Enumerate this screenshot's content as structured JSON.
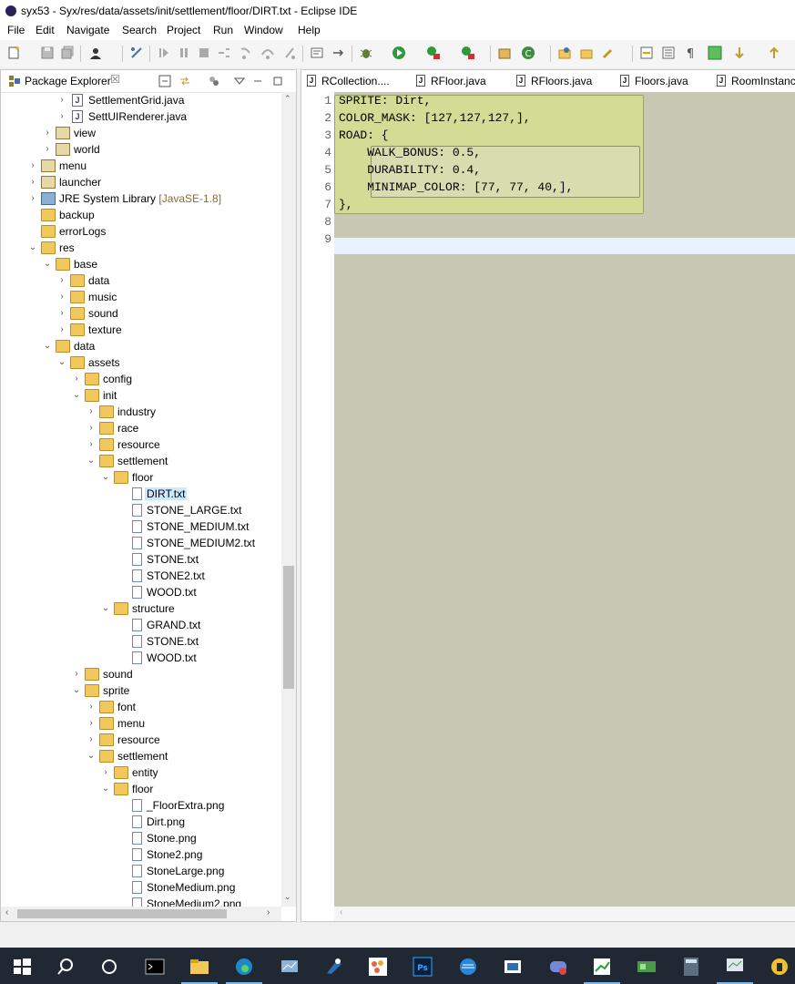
{
  "window": {
    "title": "syx53 - Syx/res/data/assets/init/settlement/floor/DIRT.txt - Eclipse IDE"
  },
  "menu": {
    "items": [
      "File",
      "Edit",
      "Navigate",
      "Search",
      "Project",
      "Run",
      "Window",
      "Help"
    ]
  },
  "package_explorer": {
    "tab_label": "Package Explorer",
    "close_glyph": "☒",
    "tree": [
      {
        "label": "SettlementGrid.java",
        "indent": 4,
        "chev": ">",
        "icon": "java"
      },
      {
        "label": "SettUIRenderer.java",
        "indent": 4,
        "chev": ">",
        "icon": "java"
      },
      {
        "label": "view",
        "indent": 3,
        "chev": ">",
        "icon": "pkg"
      },
      {
        "label": "world",
        "indent": 3,
        "chev": ">",
        "icon": "pkg"
      },
      {
        "label": "menu",
        "indent": 2,
        "chev": ">",
        "icon": "pkg"
      },
      {
        "label": "launcher",
        "indent": 2,
        "chev": ">",
        "icon": "pkg"
      },
      {
        "label": "JRE System Library",
        "deco": " [JavaSE-1.8]",
        "indent": 2,
        "chev": ">",
        "icon": "lib"
      },
      {
        "label": "backup",
        "indent": 2,
        "chev": "",
        "icon": "folder"
      },
      {
        "label": "errorLogs",
        "indent": 2,
        "chev": "",
        "icon": "folder"
      },
      {
        "label": "res",
        "indent": 2,
        "chev": "v",
        "icon": "folder"
      },
      {
        "label": "base",
        "indent": 3,
        "chev": "v",
        "icon": "folder"
      },
      {
        "label": "data",
        "indent": 4,
        "chev": ">",
        "icon": "folder"
      },
      {
        "label": "music",
        "indent": 4,
        "chev": ">",
        "icon": "folder"
      },
      {
        "label": "sound",
        "indent": 4,
        "chev": ">",
        "icon": "folder"
      },
      {
        "label": "texture",
        "indent": 4,
        "chev": ">",
        "icon": "folder"
      },
      {
        "label": "data",
        "indent": 3,
        "chev": "v",
        "icon": "folder"
      },
      {
        "label": "assets",
        "indent": 4,
        "chev": "v",
        "icon": "folder"
      },
      {
        "label": "config",
        "indent": 5,
        "chev": ">",
        "icon": "folder"
      },
      {
        "label": "init",
        "indent": 5,
        "chev": "v",
        "icon": "folder"
      },
      {
        "label": "industry",
        "indent": 6,
        "chev": ">",
        "icon": "folder"
      },
      {
        "label": "race",
        "indent": 6,
        "chev": ">",
        "icon": "folder"
      },
      {
        "label": "resource",
        "indent": 6,
        "chev": ">",
        "icon": "folder"
      },
      {
        "label": "settlement",
        "indent": 6,
        "chev": "v",
        "icon": "folder"
      },
      {
        "label": "floor",
        "indent": 7,
        "chev": "v",
        "icon": "folder"
      },
      {
        "label": "DIRT.txt",
        "indent": 8,
        "chev": "",
        "icon": "file",
        "selected": true
      },
      {
        "label": "STONE_LARGE.txt",
        "indent": 8,
        "chev": "",
        "icon": "file"
      },
      {
        "label": "STONE_MEDIUM.txt",
        "indent": 8,
        "chev": "",
        "icon": "file"
      },
      {
        "label": "STONE_MEDIUM2.txt",
        "indent": 8,
        "chev": "",
        "icon": "file"
      },
      {
        "label": "STONE.txt",
        "indent": 8,
        "chev": "",
        "icon": "file"
      },
      {
        "label": "STONE2.txt",
        "indent": 8,
        "chev": "",
        "icon": "file"
      },
      {
        "label": "WOOD.txt",
        "indent": 8,
        "chev": "",
        "icon": "file"
      },
      {
        "label": "structure",
        "indent": 7,
        "chev": "v",
        "icon": "folder"
      },
      {
        "label": "GRAND.txt",
        "indent": 8,
        "chev": "",
        "icon": "file"
      },
      {
        "label": "STONE.txt",
        "indent": 8,
        "chev": "",
        "icon": "file"
      },
      {
        "label": "WOOD.txt",
        "indent": 8,
        "chev": "",
        "icon": "file"
      },
      {
        "label": "sound",
        "indent": 5,
        "chev": ">",
        "icon": "folder"
      },
      {
        "label": "sprite",
        "indent": 5,
        "chev": "v",
        "icon": "folder"
      },
      {
        "label": "font",
        "indent": 6,
        "chev": ">",
        "icon": "folder"
      },
      {
        "label": "menu",
        "indent": 6,
        "chev": ">",
        "icon": "folder"
      },
      {
        "label": "resource",
        "indent": 6,
        "chev": ">",
        "icon": "folder"
      },
      {
        "label": "settlement",
        "indent": 6,
        "chev": "v",
        "icon": "folder"
      },
      {
        "label": "entity",
        "indent": 7,
        "chev": ">",
        "icon": "folder"
      },
      {
        "label": "floor",
        "indent": 7,
        "chev": "v",
        "icon": "folder"
      },
      {
        "label": "_FloorExtra.png",
        "indent": 8,
        "chev": "",
        "icon": "file"
      },
      {
        "label": "Dirt.png",
        "indent": 8,
        "chev": "",
        "icon": "file"
      },
      {
        "label": "Stone.png",
        "indent": 8,
        "chev": "",
        "icon": "file"
      },
      {
        "label": "Stone2.png",
        "indent": 8,
        "chev": "",
        "icon": "file"
      },
      {
        "label": "StoneLarge.png",
        "indent": 8,
        "chev": "",
        "icon": "file"
      },
      {
        "label": "StoneMedium.png",
        "indent": 8,
        "chev": "",
        "icon": "file"
      },
      {
        "label": "StoneMedium2.png",
        "indent": 8,
        "chev": "",
        "icon": "file"
      }
    ]
  },
  "editor": {
    "tabs": [
      "RCollection....",
      "RFloor.java",
      "RFloors.java",
      "Floors.java",
      "RoomInstanc"
    ],
    "lines": [
      {
        "n": "1",
        "text": "SPRITE: Dirt,"
      },
      {
        "n": "2",
        "text": "COLOR_MASK: [127,127,127,],"
      },
      {
        "n": "3",
        "text": "ROAD: {"
      },
      {
        "n": "4",
        "text": "    WALK_BONUS: 0.5,"
      },
      {
        "n": "5",
        "text": "    DURABILITY: 0.4,"
      },
      {
        "n": "6",
        "text": "    MINIMAP_COLOR: [77, 77, 40,],"
      },
      {
        "n": "7",
        "text": "},"
      },
      {
        "n": "8",
        "text": ""
      },
      {
        "n": "9",
        "text": ""
      }
    ],
    "colors": {
      "block_outer": "#d3dc95",
      "block_inner": "#d9dcaf",
      "background": "#c6c8b3"
    }
  },
  "taskbar": {
    "icons": [
      "windows-start-icon",
      "search-icon",
      "cortana-icon",
      "terminal-icon",
      "file-explorer-icon",
      "edge-icon",
      "network-icon",
      "app-icon",
      "paint-icon",
      "photoshop-icon",
      "messenger-icon",
      "app2-icon",
      "discord-icon",
      "sheet-icon",
      "gpu-icon",
      "calculator-icon",
      "monitor-icon",
      "notification-icon"
    ]
  }
}
